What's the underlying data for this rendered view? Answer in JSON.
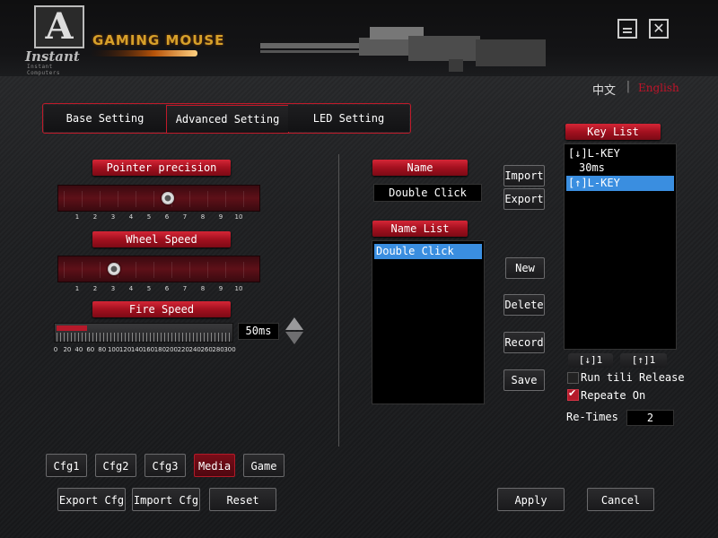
{
  "header": {
    "logo_text": "Instant",
    "logo_sub": "Instant Computers",
    "brand": "GAMING MOUSE",
    "minimize_icon": "minimize-icon",
    "close_icon": "close-icon",
    "close_glyph": "✕"
  },
  "language": {
    "zh": "中文",
    "separator": "|",
    "en": "English",
    "active_color": "#c0142a"
  },
  "tabs": [
    {
      "label": "Base Setting"
    },
    {
      "label": "Advanced Setting",
      "active": true
    },
    {
      "label": "LED Setting"
    }
  ],
  "pointer_precision": {
    "label": "Pointer precision",
    "value": 6,
    "scale": [
      "1",
      "2",
      "3",
      "4",
      "5",
      "6",
      "7",
      "8",
      "9",
      "10"
    ]
  },
  "wheel_speed": {
    "label": "Wheel Speed",
    "value": 3,
    "scale": [
      "1",
      "2",
      "3",
      "4",
      "5",
      "6",
      "7",
      "8",
      "9",
      "10"
    ]
  },
  "fire_speed": {
    "label": "Fire Speed",
    "value_text": "50ms",
    "value": 50,
    "scale": [
      "0",
      "20",
      "40",
      "60",
      "80",
      "100",
      "120",
      "140",
      "160",
      "180",
      "200",
      "220",
      "240",
      "260",
      "280",
      "300"
    ]
  },
  "macro": {
    "name_label": "Name",
    "name_value": "Double Click",
    "name_list_label": "Name List",
    "name_list": [
      "Double Click"
    ],
    "import_label": "Import",
    "export_label": "Export",
    "new_label": "New",
    "delete_label": "Delete",
    "record_label": "Record",
    "save_label": "Save"
  },
  "key_list": {
    "label": "Key List",
    "items": [
      "[↓]L-KEY",
      "  30ms",
      "[↑]L-KEY"
    ],
    "selected_index": 2,
    "down_button": "[↓]1",
    "up_button": "[↑]1",
    "run_till_release": "Run tili Release",
    "run_till_release_checked": false,
    "repeate_on": "Repeate On",
    "repeate_on_checked": true,
    "re_times_label": "Re-Times",
    "re_times_value": "2"
  },
  "configs": [
    {
      "label": "Cfg1"
    },
    {
      "label": "Cfg2"
    },
    {
      "label": "Cfg3"
    },
    {
      "label": "Media",
      "active": true
    },
    {
      "label": "Game"
    }
  ],
  "footer": {
    "export_cfg": "Export Cfg",
    "import_cfg": "Import Cfg",
    "reset": "Reset",
    "apply": "Apply",
    "cancel": "Cancel"
  },
  "colors": {
    "accent_red": "#c01a2a",
    "selection_blue": "#3a8ee0",
    "brand_gold": "#d6a02a"
  }
}
